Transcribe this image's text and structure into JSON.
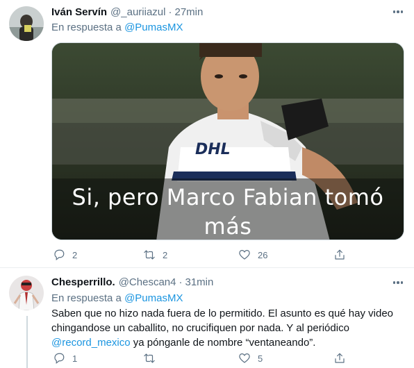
{
  "tweets": [
    {
      "name": "Iván Servín",
      "handle": "@_auriiazul",
      "separator": "·",
      "time": "27min",
      "reply_prefix": "En respuesta a",
      "reply_to": "@PumasMX",
      "media_caption_line1": "Si, pero Marco Fabian tomó",
      "media_caption_line2": "más",
      "jersey_text": "DHL",
      "counts": {
        "reply": "2",
        "retweet": "2",
        "like": "26"
      }
    },
    {
      "name": "Chesperrillo.",
      "handle": "@Chescan4",
      "separator": "·",
      "time": "31min",
      "reply_prefix": "En respuesta a",
      "reply_to": "@PumasMX",
      "text_line1": "Saben que no hizo nada fuera de lo permitido. El asunto es qué hay video",
      "text_line2": "chingandose un caballito, no crucifiquen por nada. Y al periódico",
      "text_mention": "@record_mexico",
      "text_line3_rest": " ya pónganle de nombre “ventaneando”.",
      "counts": {
        "reply": "1",
        "retweet": "",
        "like": "5"
      }
    }
  ],
  "colors": {
    "link": "#1b95e0",
    "secondary": "#5b7083",
    "text": "#0f1419"
  },
  "icons": [
    "more-icon",
    "reply-icon",
    "retweet-icon",
    "like-icon",
    "share-icon"
  ]
}
